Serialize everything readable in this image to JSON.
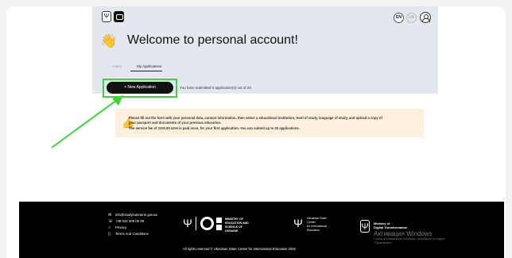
{
  "header": {
    "logo_trident": "Ψ",
    "lang_en": "EN",
    "lang_ua": "UA",
    "title": "Welcome to personal account!",
    "title_icon": "👋"
  },
  "tabs": [
    {
      "label": "Inbox"
    },
    {
      "label": "My Applications"
    }
  ],
  "main": {
    "new_application_label": "+ New Application",
    "count_text": "You have submitted 0 application(s) out of 20.",
    "notice_icon": "👍",
    "notice_line1": "Please fill out the form with your personal data, contact information, then select a educational institution, level of study, language of study, and upload a copy of",
    "notice_line2": "your passport and documents of your previous education.",
    "notice_line3": "The service fee of 3100.00 UAH is paid once, for your first application. You can submit up to 20 applications.",
    "highlight_color": "#39d63a"
  },
  "footer": {
    "email": "info@studyinukraine.gov.ua",
    "phone": "+38 044 309 05 39",
    "privacy": "Privacy",
    "terms": "Terms And Conditions",
    "ministry_line1": "MINISTRY OF",
    "ministry_line2": "EDUCATION AND",
    "ministry_line3": "SCIENCE OF",
    "ministry_line4": "UKRAINE",
    "usc_line1": "Ukrainian State",
    "usc_line2": "Center",
    "usc_line3": "for International",
    "usc_line4": "Education",
    "mdt_line1": "Ministry of",
    "mdt_line2": "Digital Transformation",
    "rights": "All rights reserved © Ukrainian State Center for International Education 2025"
  },
  "watermark": {
    "title": "Активация Windows",
    "line1": "Чтобы активировать Windows, перейдите в раздел",
    "line2": "\"Параметры\"."
  }
}
